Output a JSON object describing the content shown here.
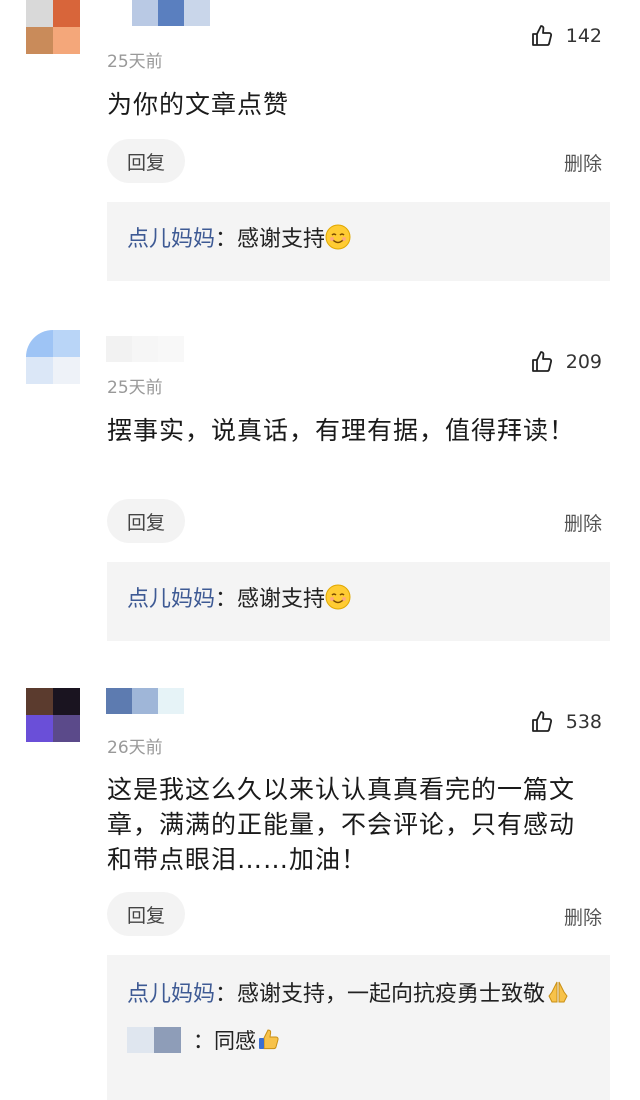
{
  "comments": [
    {
      "time": "25天前",
      "likes": "142",
      "text": "为你的文章点赞",
      "reply_label": "回复",
      "delete_label": "删除",
      "reply": {
        "author": "点儿妈妈",
        "separator": "：",
        "text": "感谢支持"
      }
    },
    {
      "time": "25天前",
      "likes": "209",
      "text": "摆事实，说真话，有理有据，值得拜读！",
      "reply_label": "回复",
      "delete_label": "删除",
      "reply": {
        "author": "点儿妈妈",
        "separator": "：",
        "text": "感谢支持"
      }
    },
    {
      "time": "26天前",
      "likes": "538",
      "text": "这是我这么久以来认认真真看完的一篇文章，满满的正能量，不会评论，只有感动和带点眼泪……加油！",
      "reply_label": "回复",
      "delete_label": "删除",
      "reply": {
        "author": "点儿妈妈",
        "separator": "：",
        "text": "感谢支持，一起向抗疫勇士致敬"
      },
      "sub_reply": {
        "separator": "：",
        "text": "同感"
      }
    }
  ],
  "colors": {
    "author": "#3e5a94",
    "reply_bg": "#f4f4f4",
    "button_bg": "#f3f3f3",
    "meta": "#999999"
  },
  "icons": {
    "like": "thumbs-up-icon",
    "smile": "smiling-face-emoji",
    "pray": "folded-hands-emoji",
    "thumb": "thumbs-up-emoji"
  }
}
